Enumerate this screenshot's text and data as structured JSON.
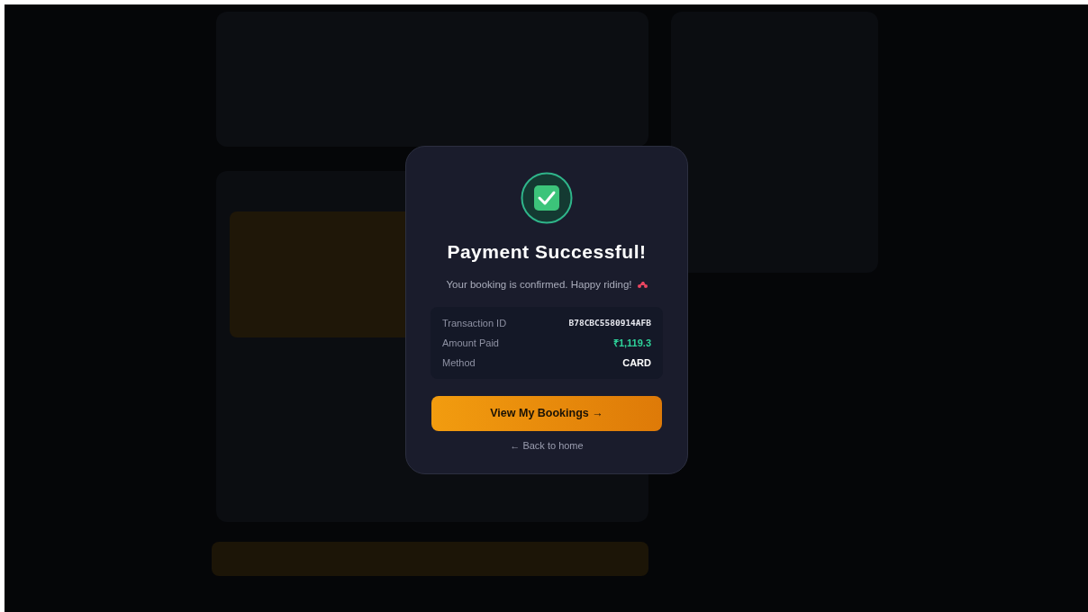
{
  "dialog": {
    "title": "Payment Successful!",
    "message": "Your booking is confirmed. Happy riding!",
    "details": [
      {
        "label": "Transaction ID",
        "value": "B78CBC5580914AFB",
        "kind": "code"
      },
      {
        "label": "Amount Paid",
        "value": "₹1,119.3",
        "kind": "amount"
      },
      {
        "label": "Method",
        "value": "CARD",
        "kind": "plain"
      }
    ],
    "primary_button": "View My Bookings →",
    "secondary_link": "← Back to home"
  }
}
